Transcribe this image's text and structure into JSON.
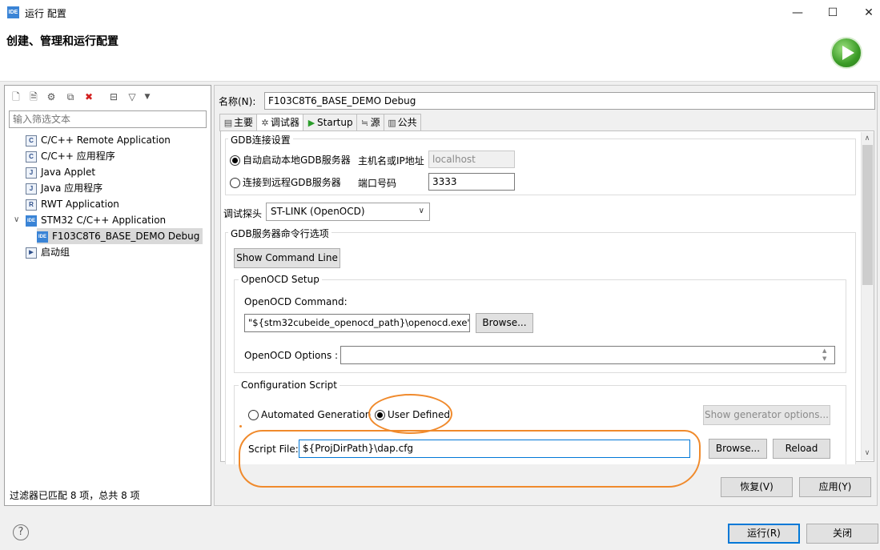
{
  "window": {
    "app_icon_text": "IDE",
    "title": "运行 配置",
    "minimize": "—",
    "maximize": "☐",
    "close": "✕",
    "heading": "创建、管理和运行配置"
  },
  "left": {
    "filter_placeholder": "输入筛选文本",
    "tree": [
      {
        "icon": "C",
        "label": "C/C++ Remote Application"
      },
      {
        "icon": "C",
        "label": "C/C++ 应用程序"
      },
      {
        "icon": "J",
        "label": "Java Applet"
      },
      {
        "icon": "J",
        "label": "Java 应用程序"
      },
      {
        "icon": "R",
        "label": "RWT Application"
      },
      {
        "icon": "IDE",
        "label": "STM32 C/C++ Application"
      },
      {
        "icon": "IDE",
        "label": "F103C8T6_BASE_DEMO Debug"
      },
      {
        "icon": "▶",
        "label": "启动组"
      }
    ],
    "status": "过滤器已匹配 8 项，总共 8 项"
  },
  "right": {
    "name_label": "名称(N):",
    "name_value": "F103C8T6_BASE_DEMO Debug",
    "tabs": [
      "主要",
      "调试器",
      "Startup",
      "源",
      "公共"
    ],
    "gdb_group": "GDB连接设置",
    "auto_start": "自动启动本地GDB服务器",
    "host_label": "主机名或IP地址",
    "host_value": "localhost",
    "connect_remote": "连接到远程GDB服务器",
    "port_label": "端口号码",
    "port_value": "3333",
    "probe_label": "调试探头",
    "probe_value": "ST-LINK (OpenOCD)",
    "gdb_cmd_group": "GDB服务器命令行选项",
    "show_cmd_btn": "Show Command Line",
    "openocd_group": "OpenOCD Setup",
    "openocd_cmd_label": "OpenOCD Command:",
    "openocd_cmd_value": "\"${stm32cubeide_openocd_path}\\openocd.exe\"",
    "browse_btn": "Browse...",
    "openocd_opts_label": "OpenOCD Options :",
    "openocd_opts_value": "",
    "config_group": "Configuration Script",
    "automated": "Automated Generation",
    "user_defined": "User Defined",
    "show_gen_btn": "Show generator options...",
    "script_label": "Script File:",
    "script_value": "${ProjDirPath}\\dap.cfg",
    "browse2_btn": "Browse...",
    "reload_btn": "Reload",
    "revert_btn": "恢复(V)",
    "apply_btn": "应用(Y)"
  },
  "footer": {
    "help": "?",
    "run_btn": "运行(R)",
    "close_btn": "关闭"
  },
  "colors": {
    "accent": "#0078d7",
    "annotation": "#f08a2c",
    "run_green": "#3a9b26"
  }
}
